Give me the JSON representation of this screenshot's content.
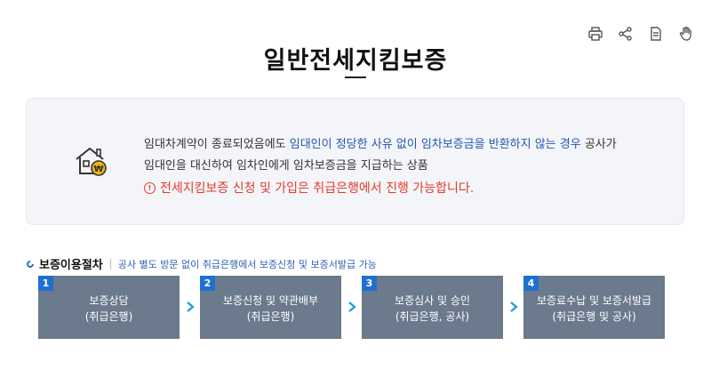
{
  "page": {
    "title": "일반전세지킴보증"
  },
  "info": {
    "desc_line1_a": "임대차계약이 종료되었음에도 ",
    "desc_line1_highlight": "임대인이 정당한 사유 없이 임차보증금을 반환하지 않는 경우",
    "desc_line1_b": " 공사가",
    "desc_line2": "임대인을 대신하여 임차인에게 임차보증금을 지급하는 상품",
    "warning": "전세지킴보증 신청 및 가입은 취급은행에서 진행 가능합니다.",
    "warning_icon_glyph": "!",
    "accent_color": "#2456b0",
    "warning_color": "#e33b2b"
  },
  "procedure": {
    "title": "보증이용절차",
    "subtitle": "공사 별도 방문 없이 취급은행에서 보증신청 및 보증서발급 가능",
    "steps": [
      {
        "num": "1",
        "line1": "보증상담",
        "line2": "(취급은행)"
      },
      {
        "num": "2",
        "line1": "보증신청 및 약관배부",
        "line2": "(취급은행)"
      },
      {
        "num": "3",
        "line1": "보증심사 및 승인",
        "line2": "(취급은행, 공사)"
      },
      {
        "num": "4",
        "line1": "보증료수납 및 보증서발급",
        "line2": "(취급은행 및 공사)"
      }
    ]
  },
  "toolbar": {
    "icons": [
      "print-icon",
      "share-icon",
      "document-icon",
      "hand-pointer-icon"
    ]
  }
}
